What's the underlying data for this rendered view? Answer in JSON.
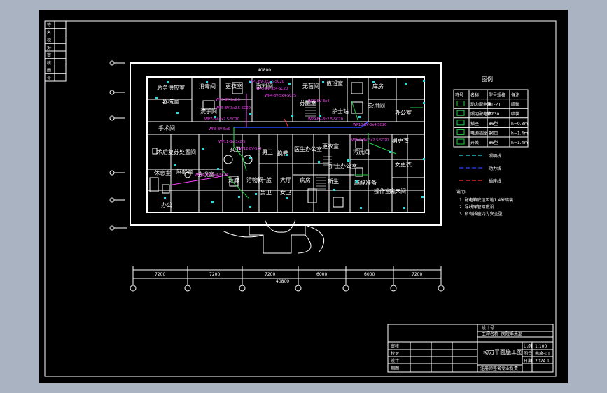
{
  "colors": {
    "background": "#000000",
    "frame": "#a9b3c2",
    "lines": "#ffffff",
    "power": "#ff44ff",
    "equipment": "#22dddd",
    "wire_blue": "#2244ff",
    "wire_green": "#22cc44",
    "wire_red": "#ff3333"
  },
  "rooms": [
    {
      "id": "r1",
      "label": "总务供应室"
    },
    {
      "id": "r2",
      "label": "消毒间"
    },
    {
      "id": "r3",
      "label": "器械室"
    },
    {
      "id": "r4",
      "label": "更衣室"
    },
    {
      "id": "r5",
      "label": "洗手间"
    },
    {
      "id": "r6",
      "label": "敷料间"
    },
    {
      "id": "r7",
      "label": "无菌间"
    },
    {
      "id": "r8",
      "label": "苏醒室"
    },
    {
      "id": "r9",
      "label": "值班室"
    },
    {
      "id": "r10",
      "label": "库房"
    },
    {
      "id": "r11",
      "label": "护士站"
    },
    {
      "id": "r12",
      "label": "杂用间"
    },
    {
      "id": "r13",
      "label": "办公室"
    },
    {
      "id": "r14",
      "label": "手术间"
    },
    {
      "id": "r15",
      "label": "术后复苏"
    },
    {
      "id": "r16",
      "label": "处置间"
    },
    {
      "id": "r17",
      "label": "女卫"
    },
    {
      "id": "r18",
      "label": "男卫"
    },
    {
      "id": "r19",
      "label": "换鞋"
    },
    {
      "id": "r20",
      "label": "医生办公室"
    },
    {
      "id": "r21",
      "label": "更衣室"
    },
    {
      "id": "r22",
      "label": "护士办公室"
    },
    {
      "id": "r23",
      "label": "污洗间"
    },
    {
      "id": "r24",
      "label": "男更衣"
    },
    {
      "id": "r25",
      "label": "女更衣"
    },
    {
      "id": "r26",
      "label": "休息室"
    },
    {
      "id": "r27",
      "label": "麻醉室"
    },
    {
      "id": "r28",
      "label": "会议室"
    },
    {
      "id": "r29",
      "label": "走廊"
    },
    {
      "id": "r30",
      "label": "污物间"
    },
    {
      "id": "r31",
      "label": "一般"
    },
    {
      "id": "r32",
      "label": "大厅"
    },
    {
      "id": "r33",
      "label": "病房"
    },
    {
      "id": "r34",
      "label": "新生"
    },
    {
      "id": "r35",
      "label": "麻醉准备"
    },
    {
      "id": "r36",
      "label": "操作室"
    },
    {
      "id": "r37",
      "label": "病床间"
    },
    {
      "id": "r38",
      "label": "办公"
    },
    {
      "id": "r39",
      "label": "男卫"
    },
    {
      "id": "r40",
      "label": "女卫"
    }
  ],
  "legend": {
    "title": "图例",
    "rows": [
      [
        "符号",
        "名称",
        "型号规格",
        "备注"
      ],
      [
        "",
        "动力配电箱",
        "XL-21",
        "暗装"
      ],
      [
        "",
        "照明配电箱",
        "PZ30",
        "暗装"
      ],
      [
        "",
        "插座",
        "86型",
        "h=0.3m"
      ],
      [
        "",
        "电源插座",
        "86型",
        "h=1.4m"
      ],
      [
        "",
        "开关",
        "86型",
        "h=1.4m"
      ]
    ],
    "lines": [
      {
        "color": "#22dddd",
        "label": "照明线"
      },
      {
        "color": "#2244ff",
        "label": "动力线"
      },
      {
        "color": "#ff3333",
        "label": "插座线"
      }
    ],
    "notes_title": "说明:",
    "notes": [
      "1. 配电箱底边距地1.4米暗装",
      "2. 导线穿管暗敷设",
      "3. 所有插座均为安全型"
    ]
  },
  "title_block": {
    "top_left": "设计号",
    "row2": "工程名称",
    "row2b": "医院手术部",
    "drawing_title": "动力平面施工图",
    "rows": [
      "审核",
      "校对",
      "设计",
      "制图"
    ],
    "meta_labels": [
      "比例",
      "图号",
      "日期"
    ],
    "meta_values": [
      "1:100",
      "电施-01",
      "2024.1"
    ],
    "bottom_left": "注册师签名",
    "bottom_mid": "专业负责",
    "cells": [
      "",
      "",
      ""
    ]
  },
  "left_strip_labels": [
    "签",
    "名",
    "校",
    "对",
    "审",
    "核",
    "图",
    "号"
  ],
  "axis_labels": [
    "1",
    "2",
    "3",
    "4",
    "5",
    "6",
    "7"
  ],
  "row_axis_labels": [
    "A",
    "B",
    "C",
    "D",
    "E"
  ],
  "dimensions": [
    "7200",
    "7200",
    "7200",
    "6000",
    "6000",
    "7200"
  ],
  "total_dimension": "40800",
  "top_dimension": "40800",
  "circuit_labels": [
    "WP1-BV-3x2.5-SC20",
    "WP2-BV-3x4-SC20",
    "WP3-BV-3x2.5",
    "WP4-BV-5x4-SC25",
    "WP5-BV-3x2.5-SC20",
    "WP6-BV-3x4",
    "WP7-BV-3x2.5-SC20",
    "WP8-BV-5x6",
    "WP9-BV-3x2.5-SC20",
    "WP10-BV-3x4-SC20",
    "WP11-BV-3x2.5",
    "WP12-BV-5x4",
    "WP13-BV-3x2.5-SC20",
    "WP14-BV-3x4-SC20"
  ]
}
